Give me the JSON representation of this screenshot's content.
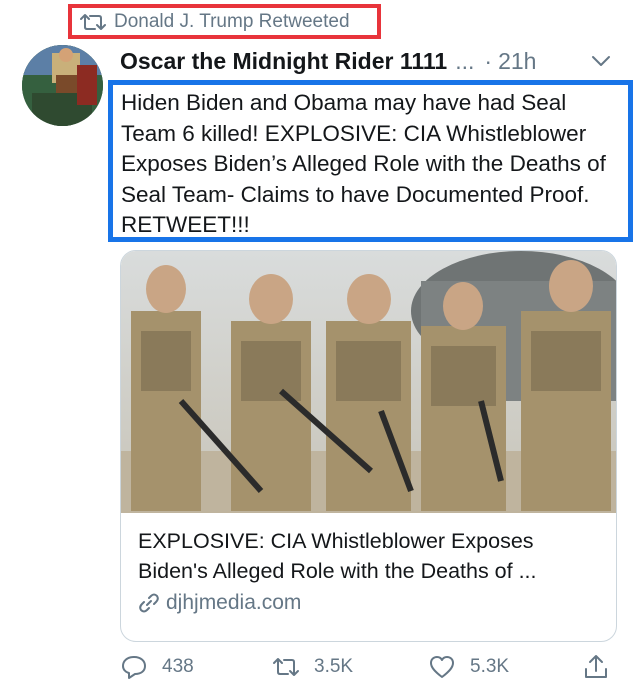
{
  "retweet": {
    "icon": "retweet-icon",
    "label": "Donald J. Trump Retweeted"
  },
  "author": {
    "name": "Oscar the Midnight Rider 1111",
    "truncation": "...",
    "separator": "·",
    "time": "21h"
  },
  "tweet": {
    "text": "Hiden Biden and Obama may have had Seal Team 6 killed! EXPLOSIVE: CIA Whistleblower Exposes Biden’s Alleged Role with the Deaths of Seal Team- Claims to have Documented Proof. RETWEET!!!"
  },
  "card": {
    "title": "EXPLOSIVE: CIA Whistleblower Exposes Biden's Alleged Role with the Deaths of ...",
    "domain": "djhjmedia.com"
  },
  "actions": {
    "replies": "438",
    "retweets": "3.5K",
    "likes": "5.3K"
  },
  "colors": {
    "highlight_red": "#e8343b",
    "highlight_blue": "#1874e8",
    "muted": "#657786"
  }
}
